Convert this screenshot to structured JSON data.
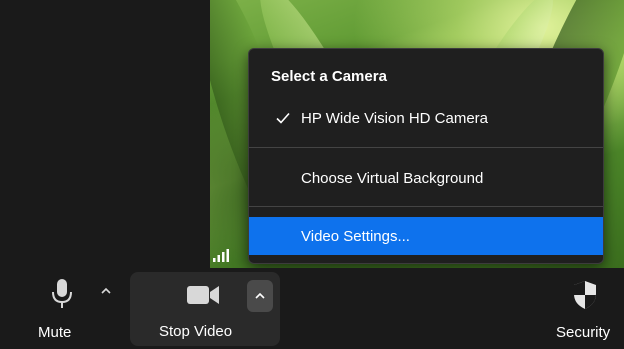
{
  "camera_menu": {
    "header": "Select a Camera",
    "items": [
      {
        "label": "HP Wide Vision HD Camera",
        "checked": true
      },
      {
        "label": "Choose Virtual Background",
        "checked": false
      },
      {
        "label": "Video Settings...",
        "checked": false,
        "highlighted": true
      }
    ]
  },
  "toolbar": {
    "mute": {
      "label": "Mute",
      "icon": "microphone-icon"
    },
    "stop_video": {
      "label": "Stop Video",
      "icon": "video-camera-icon"
    },
    "security": {
      "label": "Security",
      "icon": "shield-icon"
    }
  },
  "colors": {
    "highlight": "#0e72ed",
    "menu_bg": "#1f1f1f",
    "toolbar_bg": "#1a1a1a"
  }
}
